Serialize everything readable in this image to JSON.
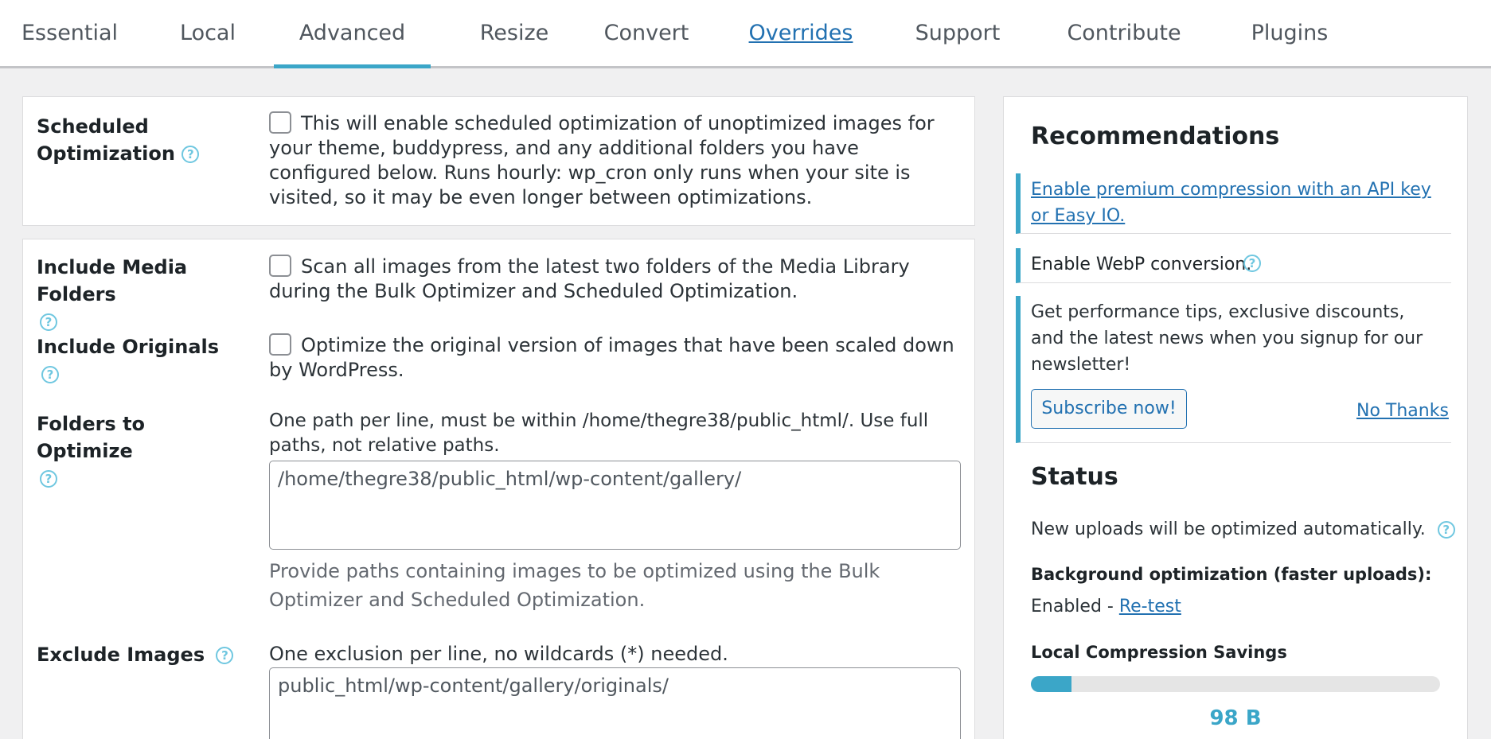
{
  "tabs": [
    "Essential",
    "Local",
    "Advanced",
    "Resize",
    "Convert",
    "Overrides",
    "Support",
    "Contribute",
    "Plugins"
  ],
  "active_tab": "Advanced",
  "scheduled": {
    "label_line1": "Scheduled",
    "label_line2": "Optimization",
    "help": "?",
    "desc": "This will enable scheduled optimization of unoptimized images for your theme, buddypress, and any additional folders you have configured below. Runs hourly: wp_cron only runs when your site is visited, so it may be even longer between optimizations."
  },
  "media_folders": {
    "label": "Include Media Folders",
    "help": "?",
    "desc": "Scan all images from the latest two folders of the Media Library during the Bulk Optimizer and Scheduled Optimization."
  },
  "originals": {
    "label": "Include Originals",
    "help": "?",
    "desc": "Optimize the original version of images that have been scaled down by WordPress."
  },
  "folders": {
    "label": "Folders to Optimize",
    "help": "?",
    "desc": "One path per line, must be within /home/thegre38/public_html/. Use full paths, not relative paths.",
    "value": "/home/thegre38/public_html/wp-content/gallery/",
    "note": "Provide paths containing images to be optimized using the Bulk Optimizer and Scheduled Optimization."
  },
  "exclude": {
    "label": "Exclude Images",
    "help": "?",
    "desc": "One exclusion per line, no wildcards (*) needed.",
    "value": "public_html/wp-content/gallery/originals/"
  },
  "sidebar": {
    "rec_title": "Recommendations",
    "rec_premium": "Enable premium compression with an API key or Easy IO.",
    "rec_webp": "Enable WebP conversion.",
    "rec_webp_help": "?",
    "newsletter_text": "Get performance tips, exclusive discounts, and the latest news when you signup for our newsletter!",
    "subscribe_label": "Subscribe now!",
    "no_thanks_label": "No Thanks",
    "status_title": "Status",
    "status_uploads": "New uploads will be optimized automatically.",
    "status_uploads_help": "?",
    "bg_title": "Background optimization (faster uploads):",
    "bg_enabled": "Enabled - ",
    "bg_retest": "Re-test",
    "savings_title": "Local Compression Savings",
    "savings_fraction": 0.1,
    "savings_value": "98 B"
  },
  "colors": {
    "accent": "#3ba6c8",
    "link": "#2271b1"
  }
}
